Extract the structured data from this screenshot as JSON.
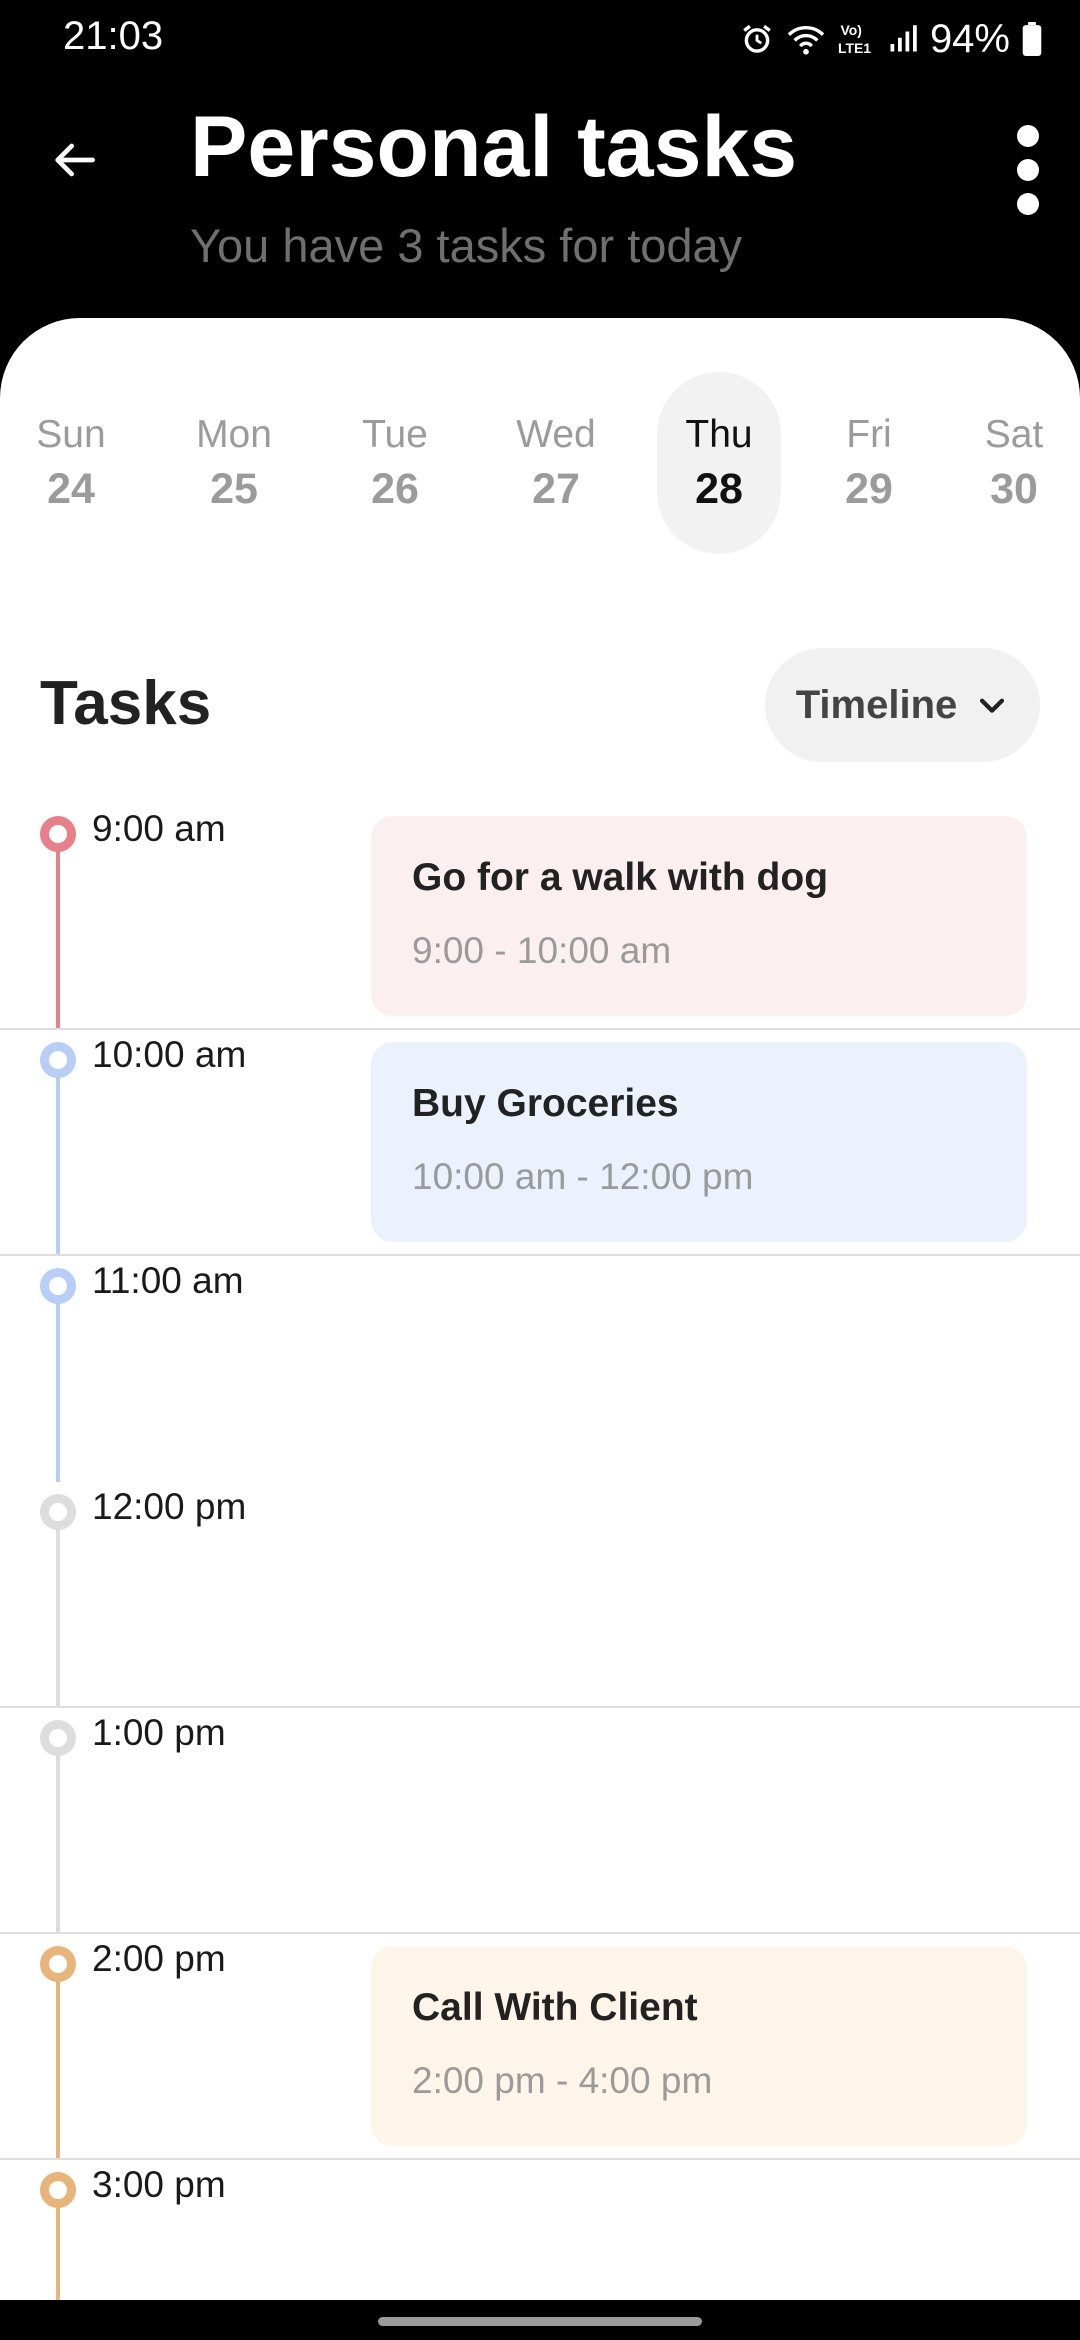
{
  "status_bar": {
    "time": "21:03",
    "battery_pct": "94%",
    "icons": [
      "alarm-icon",
      "wifi-icon",
      "volte-icon",
      "signal-icon",
      "battery-icon"
    ]
  },
  "header": {
    "title": "Personal tasks",
    "subtitle": "You have 3 tasks for today",
    "back_icon": "back-arrow-icon",
    "menu_icon": "more-vert-icon"
  },
  "week": {
    "days": [
      {
        "name": "Sun",
        "num": "24"
      },
      {
        "name": "Mon",
        "num": "25"
      },
      {
        "name": "Tue",
        "num": "26"
      },
      {
        "name": "Wed",
        "num": "27"
      },
      {
        "name": "Thu",
        "num": "28",
        "selected": true
      },
      {
        "name": "Fri",
        "num": "29"
      },
      {
        "name": "Sat",
        "num": "30"
      }
    ]
  },
  "tasks_section": {
    "heading": "Tasks",
    "view_label": "Timeline",
    "view_icon": "chevron-down-icon"
  },
  "timeline": {
    "slots": [
      {
        "time": "9:00 am",
        "color": "#e8808a",
        "task": {
          "title": "Go for a walk with dog",
          "time": "9:00 - 10:00 am",
          "bg": "#fbeff0"
        }
      },
      {
        "time": "10:00 am",
        "color": "#b9cef5",
        "task": {
          "title": "Buy Groceries",
          "time": "10:00 am - 12:00 pm",
          "bg": "#ecf2fd"
        }
      },
      {
        "time": "11:00 am",
        "color": "#b9cef5"
      },
      {
        "time": "12:00 pm",
        "color": "#dddddd"
      },
      {
        "time": "1:00 pm",
        "color": "#dddddd"
      },
      {
        "time": "2:00 pm",
        "color": "#e7b57a",
        "task": {
          "title": "Call With Client",
          "time": "2:00 pm - 4:00 pm",
          "bg": "#fdf5e9"
        }
      },
      {
        "time": "3:00 pm",
        "color": "#e7b57a"
      }
    ]
  }
}
